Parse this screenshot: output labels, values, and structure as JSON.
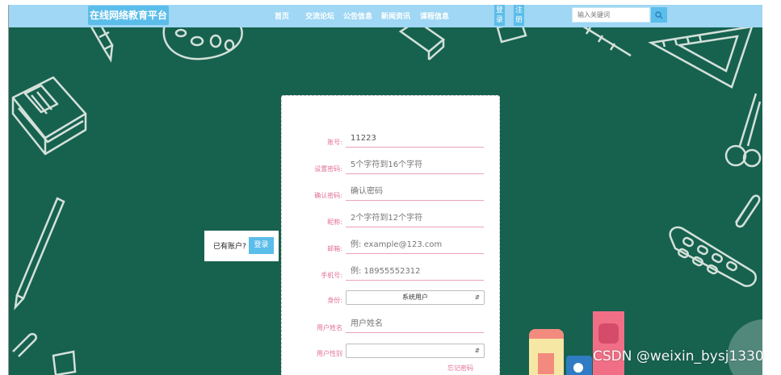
{
  "header": {
    "brand": "在线网络教育平台",
    "nav": [
      "首页",
      "交流论坛",
      "公告信息",
      "新闻资讯",
      "课程信息"
    ],
    "login_label": "登录",
    "register_label": "注册",
    "search": {
      "placeholder": "输入关键词",
      "icon": "search-icon"
    }
  },
  "login_hint": {
    "text": "已有账户?",
    "button": "登录"
  },
  "form": {
    "account": {
      "label": "账号:",
      "value": "11223"
    },
    "password": {
      "label": "设置密码:",
      "placeholder": "5个字符到16个字符"
    },
    "confirm_password": {
      "label": "确认密码:",
      "placeholder": "确认密码"
    },
    "nickname": {
      "label": "昵称:",
      "placeholder": "2个字符到12个字符"
    },
    "email": {
      "label": "邮箱:",
      "placeholder": "例: example@123.com"
    },
    "phone": {
      "label": "手机号:",
      "placeholder": "例: 18955552312"
    },
    "identity": {
      "label": "身份:",
      "selected": "系统用户"
    },
    "user_name": {
      "label": "用户姓名",
      "placeholder": "用户姓名"
    },
    "user_gender": {
      "label": "用户性别",
      "selected": ""
    },
    "forgot": "忘记密码"
  },
  "watermark": "CSDN @weixin_bysj1330",
  "colors": {
    "background": "#17614f",
    "header": "#9fd7f4",
    "accent": "#5bbde9",
    "label_pink": "#e06f96"
  }
}
